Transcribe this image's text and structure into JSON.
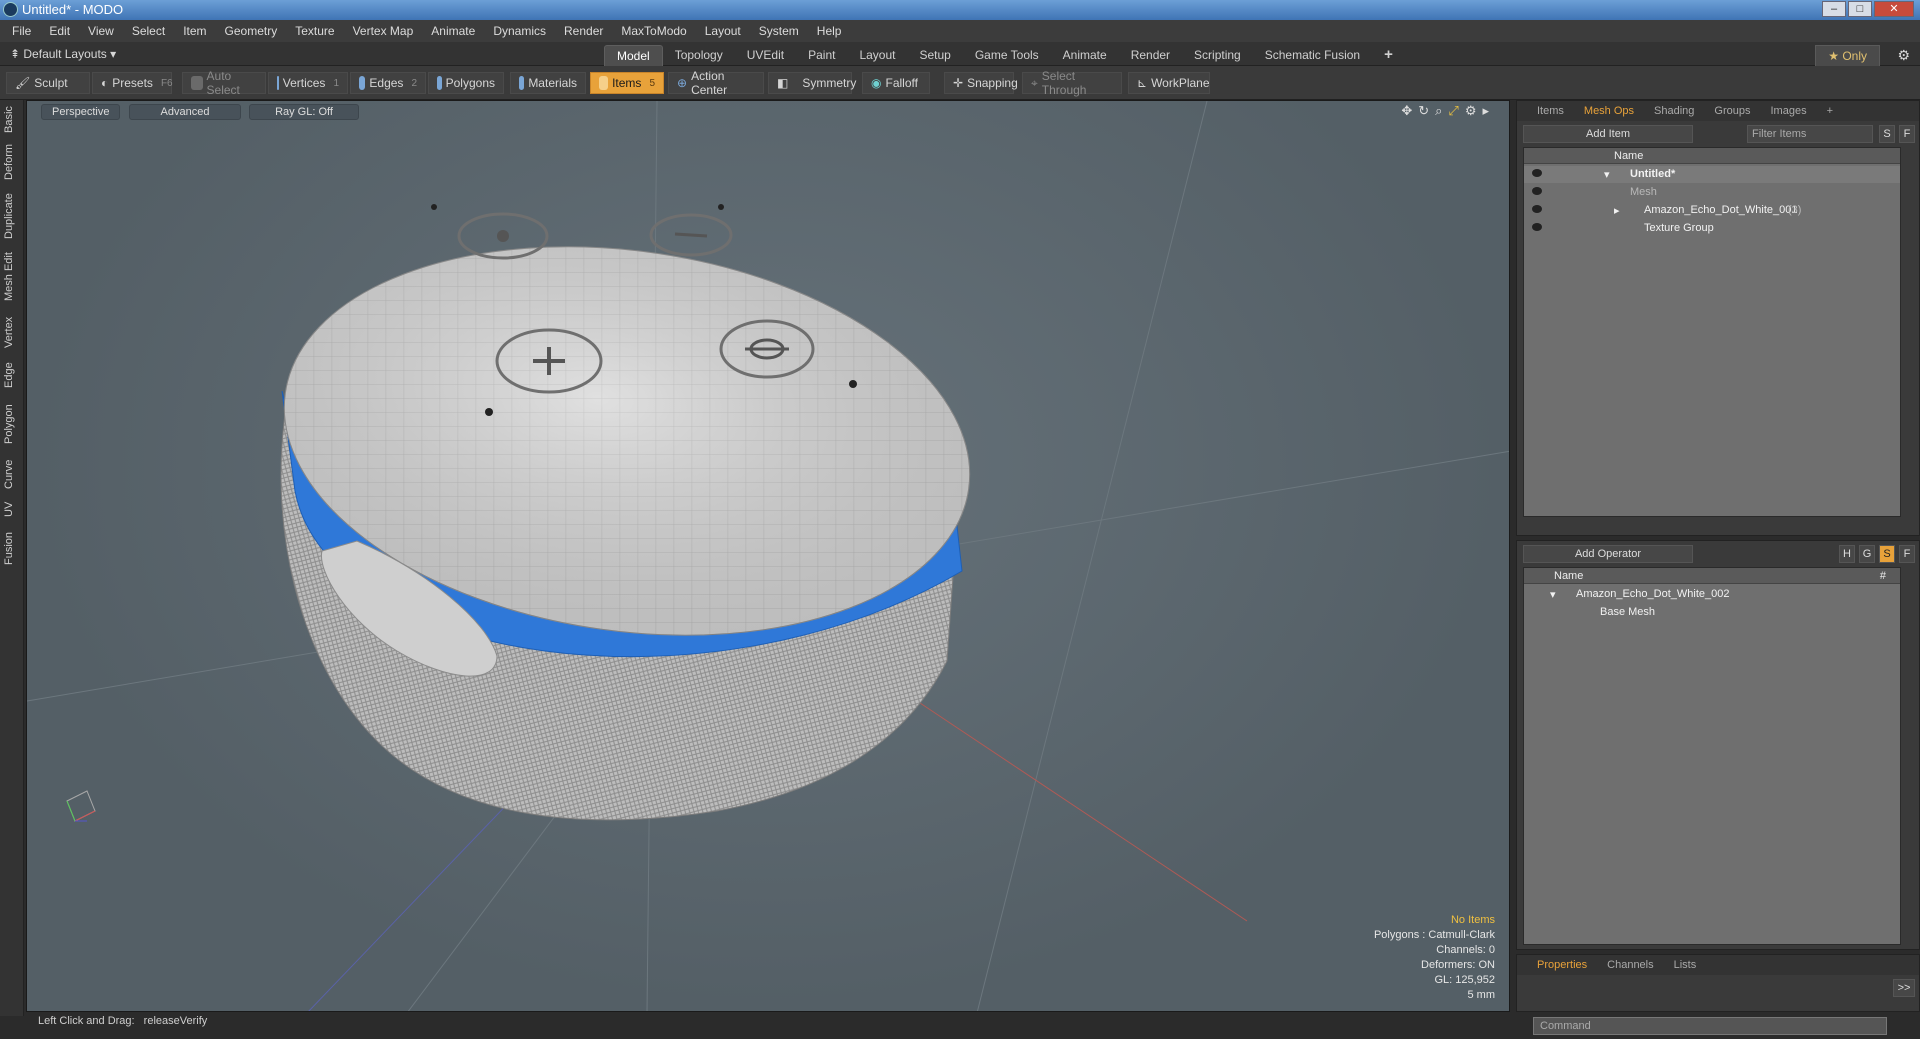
{
  "window": {
    "title": "Untitled* - MODO"
  },
  "menu": [
    "File",
    "Edit",
    "View",
    "Select",
    "Item",
    "Geometry",
    "Texture",
    "Vertex Map",
    "Animate",
    "Dynamics",
    "Render",
    "MaxToModo",
    "Layout",
    "System",
    "Help"
  ],
  "layout": {
    "selector": "Default Layouts",
    "tabs": [
      "Model",
      "Topology",
      "UVEdit",
      "Paint",
      "Layout",
      "Setup",
      "Game Tools",
      "Animate",
      "Render",
      "Scripting",
      "Schematic Fusion"
    ],
    "active_tab": "Model",
    "only_label": "Only",
    "add_tab": "+"
  },
  "toolbar": {
    "sculpt": "Sculpt",
    "presets": "Presets",
    "presets_key": "F6",
    "auto_select": "Auto Select",
    "vertices": "Vertices",
    "vertices_key": "1",
    "edges": "Edges",
    "edges_key": "2",
    "polygons": "Polygons",
    "materials": "Materials",
    "items": "Items",
    "items_key": "5",
    "action_center": "Action Center",
    "symmetry": "Symmetry",
    "falloff": "Falloff",
    "snapping": "Snapping",
    "select_through": "Select Through",
    "workplane": "WorkPlane"
  },
  "left_tabs": [
    "Basic",
    "Deform",
    "Duplicate",
    "Mesh Edit",
    "Vertex",
    "Edge",
    "Polygon",
    "Curve",
    "UV",
    "Fusion"
  ],
  "viewport": {
    "view": "Perspective",
    "shading": "Advanced",
    "raygl": "Ray GL: Off",
    "info": {
      "no_items": "No Items",
      "polygons": "Polygons : Catmull-Clark",
      "channels": "Channels: 0",
      "deformers": "Deformers: ON",
      "gl": "GL: 125,952",
      "scale": "5 mm"
    }
  },
  "status": {
    "hint": "Left Click and Drag:",
    "action": "releaseVerify"
  },
  "items_panel": {
    "tabs": [
      "Items",
      "Mesh Ops",
      "Shading",
      "Groups",
      "Images"
    ],
    "active": "Mesh Ops",
    "add_item": "Add Item",
    "filter": "Filter Items",
    "s_btn": "S",
    "f_btn": "F",
    "col_name": "Name",
    "rows": [
      {
        "label": "Untitled*",
        "bold": true
      },
      {
        "label": "Mesh",
        "dim": true
      },
      {
        "label": "Amazon_Echo_Dot_White_001",
        "suffix": "(3)"
      },
      {
        "label": "Texture Group"
      }
    ]
  },
  "ops_panel": {
    "add_operator": "Add Operator",
    "col_name": "Name",
    "col_hash": "#",
    "rows": [
      {
        "label": "Amazon_Echo_Dot_White_002"
      },
      {
        "label": "Base Mesh"
      }
    ],
    "btns": [
      "H",
      "G",
      "S",
      "F"
    ]
  },
  "bottom_panel": {
    "tabs": [
      "Properties",
      "Channels",
      "Lists"
    ],
    "active": "Properties",
    "more": ">>"
  },
  "command": {
    "placeholder": "Command"
  },
  "colors": {
    "accent": "#e8a23a",
    "ring": "#2f78d8",
    "viewport": "#5d686f"
  }
}
